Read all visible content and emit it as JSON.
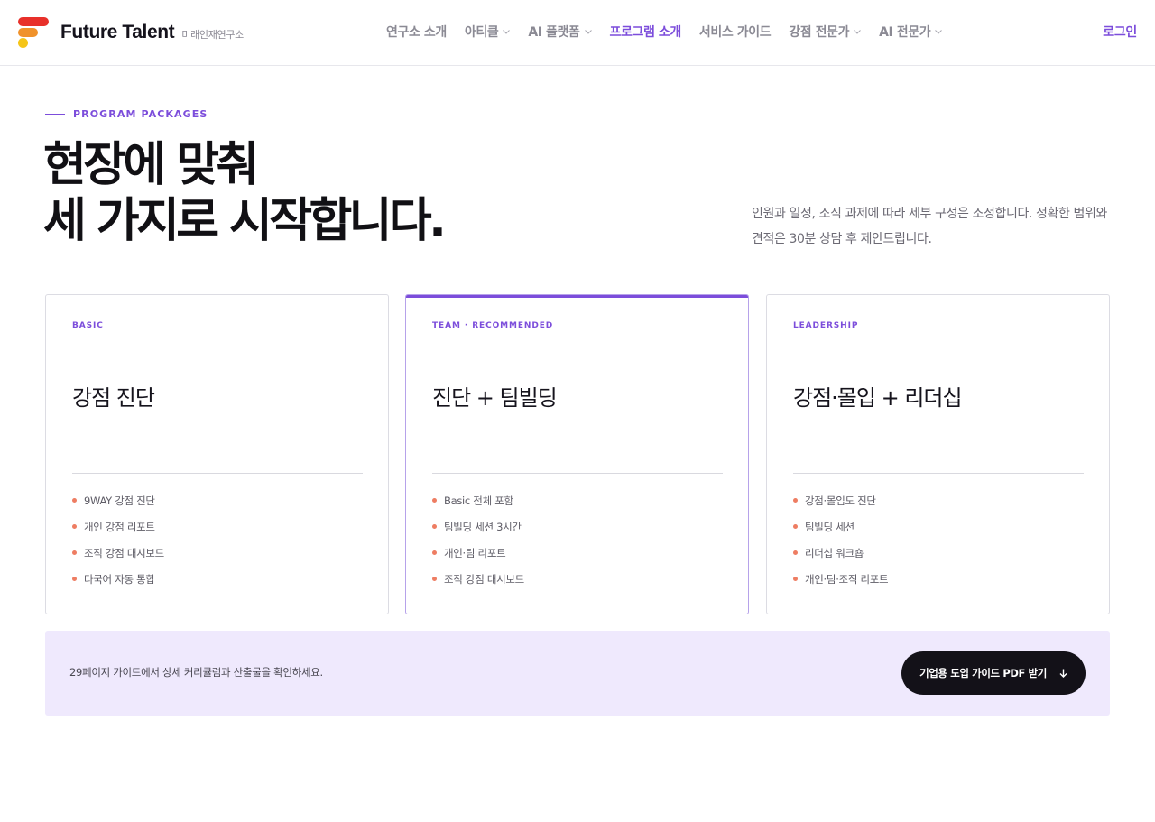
{
  "header": {
    "logo_text": "Future Talent",
    "logo_sub": "미래인재연구소",
    "nav": [
      {
        "label": "연구소 소개",
        "dropdown": false
      },
      {
        "label": "아티클",
        "dropdown": true
      },
      {
        "label": "AI 플랫폼",
        "dropdown": true
      },
      {
        "label": "프로그램 소개",
        "dropdown": false,
        "active": true
      },
      {
        "label": "서비스 가이드",
        "dropdown": false
      },
      {
        "label": "강점 전문가",
        "dropdown": true
      },
      {
        "label": "AI 전문가",
        "dropdown": true
      }
    ],
    "login": "로그인"
  },
  "intro": {
    "eyebrow": "PROGRAM PACKAGES",
    "title_line1": "현장에 맞춰",
    "title_line2": "세 가지로 시작합니다.",
    "description": "인원과 일정, 조직 과제에 따라 세부 구성은 조정합니다. 정확한 범위와 견적은 30분 상담 후 제안드립니다."
  },
  "cards": [
    {
      "tag": "BASIC",
      "title": "강점 진단",
      "items": [
        "9WAY 강점 진단",
        "개인 강점 리포트",
        "조직 강점 대시보드",
        "다국어 자동 통합"
      ]
    },
    {
      "tag": "TEAM · RECOMMENDED",
      "title": "진단 + 팀빌딩",
      "items": [
        "Basic 전체 포함",
        "팀빌딩 세션 3시간",
        "개인·팀 리포트",
        "조직 강점 대시보드"
      ]
    },
    {
      "tag": "LEADERSHIP",
      "title": "강점·몰입 + 리더십",
      "items": [
        "강점·몰입도 진단",
        "팀빌딩 세션",
        "리더십 워크숍",
        "개인·팀·조직 리포트"
      ]
    }
  ],
  "cta": {
    "text": "29페이지 가이드에서 상세 커리큘럼과 산출물을 확인하세요.",
    "button_label": "기업용 도입 가이드 PDF 받기"
  },
  "colors": {
    "accent": "#7c4ddb",
    "bullet": "#ee7d62",
    "cta_bg": "#efe9fd",
    "button_bg": "#131118",
    "logo_red": "#e8302a",
    "logo_orange": "#f0922b",
    "logo_yellow": "#f5c518"
  },
  "icons": {
    "nav_dropdown": "chevron-down-icon",
    "cta_button": "arrow-down-icon"
  }
}
